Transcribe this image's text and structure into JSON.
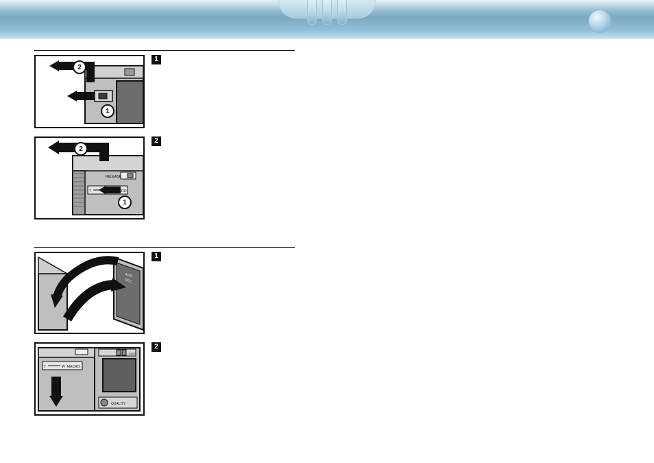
{
  "steps": {
    "s1": "1",
    "s2": "2"
  },
  "circled": {
    "c1": "1",
    "c2": "2"
  },
  "microtext": {
    "t": "T",
    "w": "W",
    "macro": "MACRO",
    "release": "RELEASE",
    "disp": "DISP",
    "quality": "QUALITY",
    "awb": "AWB",
    "rec": "REC"
  }
}
